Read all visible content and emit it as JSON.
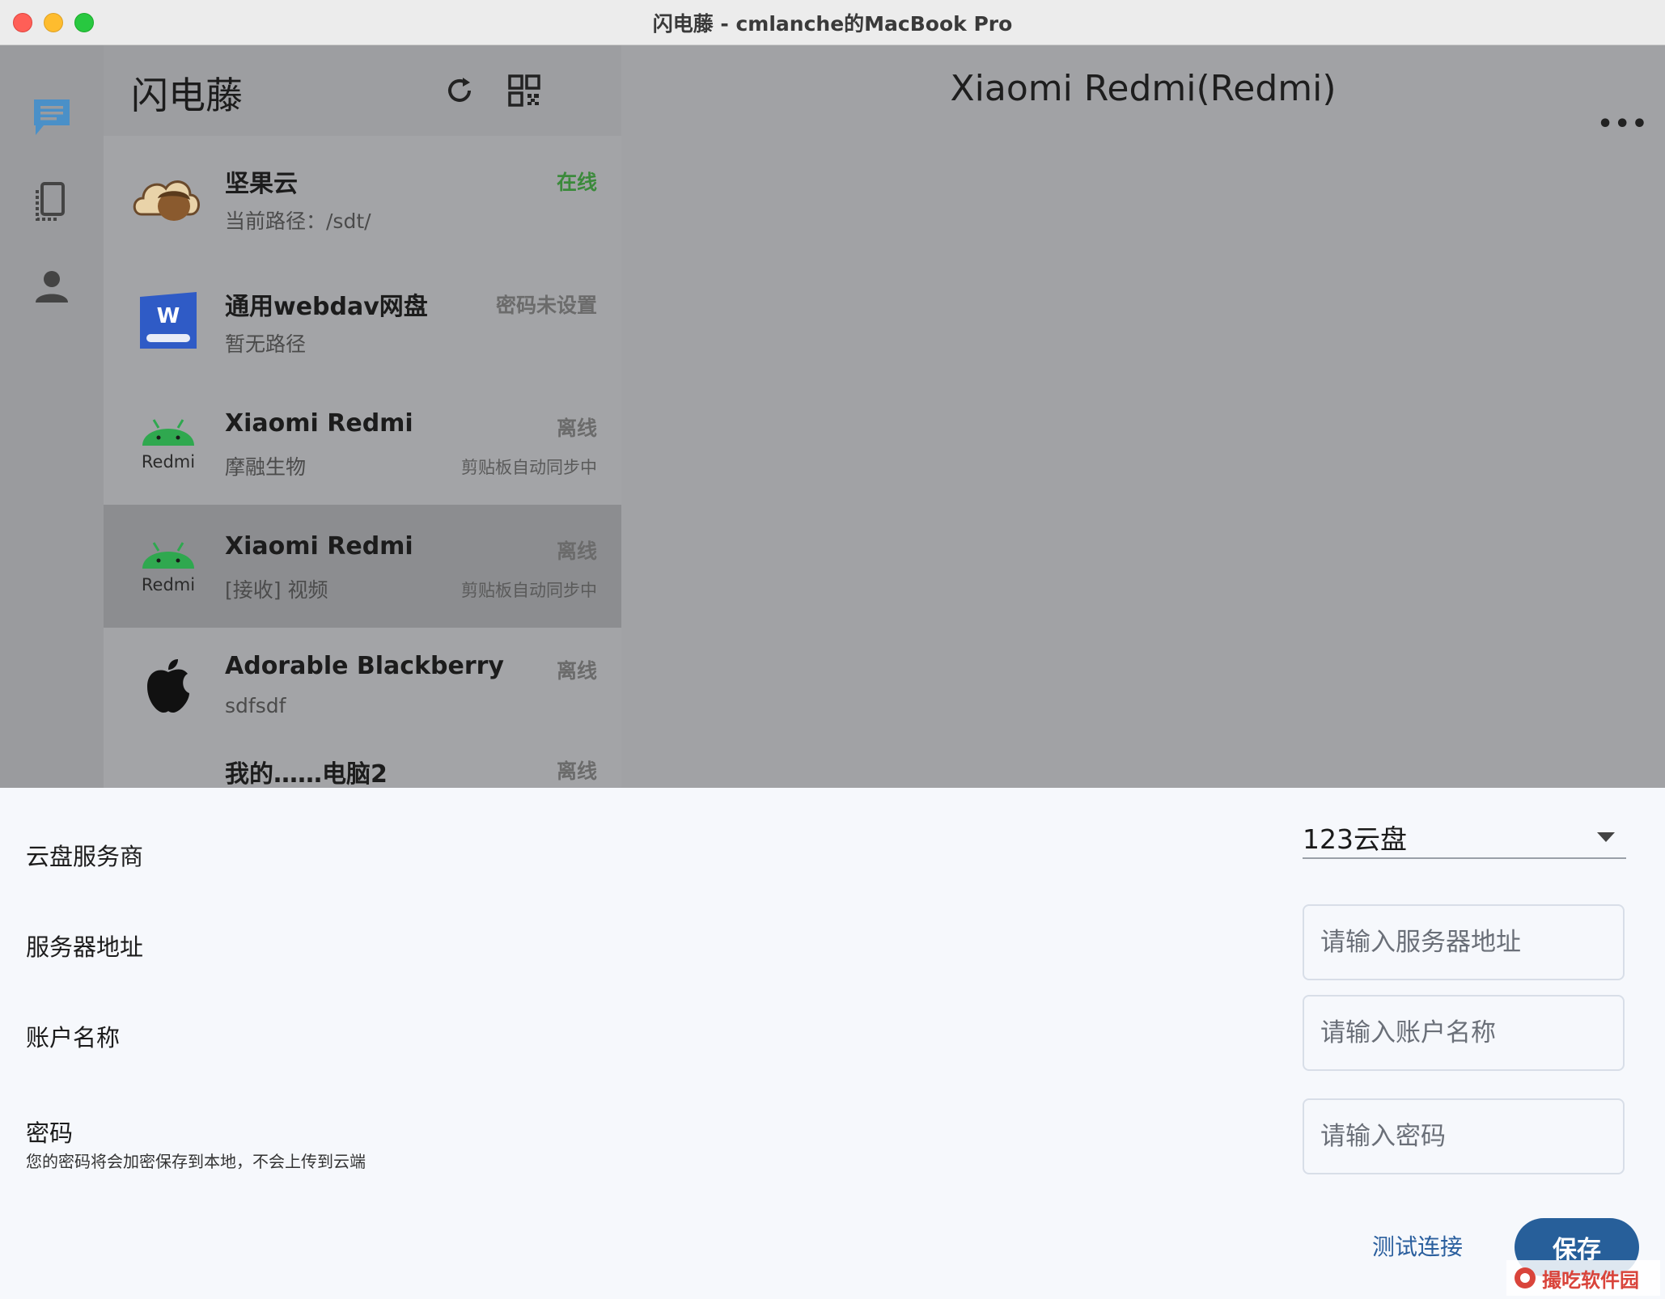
{
  "window": {
    "title": "闪电藤 - cmlanche的MacBook Pro"
  },
  "app": {
    "list_title": "闪电藤",
    "rail_items": [
      {
        "name": "messages",
        "icon": "chat-icon",
        "active": true
      },
      {
        "name": "devices",
        "icon": "devices-icon",
        "active": false
      },
      {
        "name": "profile",
        "icon": "person-icon",
        "active": false
      }
    ],
    "header_icons": [
      "refresh-icon",
      "qrcode-icon",
      "add-circle-icon"
    ],
    "devices": [
      {
        "name": "坚果云",
        "sub": "当前路径：/sdt/",
        "status": "在线",
        "status_type": "online",
        "note": "",
        "icon": "nutstore-icon",
        "caption": ""
      },
      {
        "name": "通用webdav网盘",
        "sub": "暂无路径",
        "status": "密码未设置",
        "status_type": "neutral",
        "note": "",
        "icon": "webdav-icon",
        "caption": ""
      },
      {
        "name": "Xiaomi Redmi",
        "sub": "摩融生物",
        "status": "离线",
        "status_type": "offline",
        "note": "剪贴板自动同步中",
        "icon": "android-icon",
        "caption": "Redmi"
      },
      {
        "name": "Xiaomi Redmi",
        "sub": "[接收] 视频",
        "status": "离线",
        "status_type": "offline",
        "note": "剪贴板自动同步中",
        "icon": "android-icon",
        "caption": "Redmi",
        "selected": true
      },
      {
        "name": "Adorable Blackberry",
        "sub": "sdfsdf",
        "status": "离线",
        "status_type": "offline",
        "note": "",
        "icon": "apple-icon",
        "caption": ""
      }
    ],
    "partial_item": {
      "name": "我的……电脑2",
      "status": "离线"
    },
    "detail_title": "Xiaomi Redmi(Redmi)",
    "more_label": "•••"
  },
  "form": {
    "provider_label": "云盘服务商",
    "provider_value": "123云盘",
    "server_label": "服务器地址",
    "server_placeholder": "请输入服务器地址",
    "account_label": "账户名称",
    "account_placeholder": "请输入账户名称",
    "password_label": "密码",
    "password_hint": "您的密码将会加密保存到本地，不会上传到云端",
    "password_placeholder": "请输入密码",
    "test_label": "测试连接",
    "save_label": "保存"
  },
  "watermark": {
    "text": "撮吃软件园"
  },
  "colors": {
    "accent": "#275f9a",
    "online": "#3b8a3b",
    "android": "#2fa84f"
  }
}
